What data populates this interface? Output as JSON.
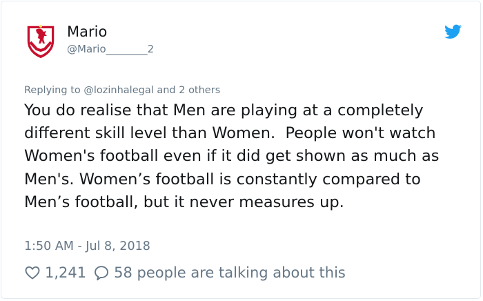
{
  "tweet": {
    "user": {
      "display_name": "Mario",
      "handle": "@Mario________2",
      "avatar_icon": "liverpool-crest-icon"
    },
    "brand_icon": "twitter-bird-icon",
    "reply_prefix": "Replying to",
    "reply_targets": "@lozinhalegal and 2 others",
    "text": "You do realise that Men are playing at a completely different skill level than Women.  People won't watch Women's football even if it did get shown as much as Men's. Women’s football is constantly compared to Men’s football, but it never measures up.",
    "timestamp": "1:50 AM - Jul 8, 2018",
    "likes": "1,241",
    "conversation": "58 people are talking about this"
  },
  "colors": {
    "text": "#14171a",
    "secondary": "#657786",
    "twitter_blue": "#1da1f2",
    "border": "#e1e8ed",
    "crest_red": "#c8102e",
    "crest_gold": "#f6eb61"
  }
}
